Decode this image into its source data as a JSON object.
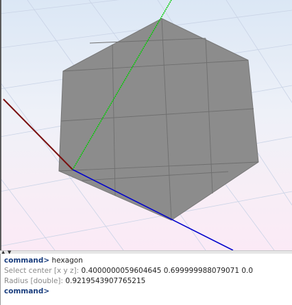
{
  "viewport": {
    "shape": "hexagon",
    "face_color": "#8c8c8c",
    "grid_line_color": "#6e6e6e",
    "axis_colors": {
      "x": "#0000cc",
      "y": "#00cc00",
      "z": "#7a1010"
    }
  },
  "console": {
    "prompt_label": "command>",
    "lines": [
      {
        "label": "command>",
        "value": "hexagon"
      },
      {
        "label": "Select center [x y z]:",
        "value": "0.4000000059604645 0.699999988079071 0.0"
      },
      {
        "label": "Radius [double]:",
        "value": "0.9219543907765215"
      }
    ],
    "input_value": ""
  }
}
